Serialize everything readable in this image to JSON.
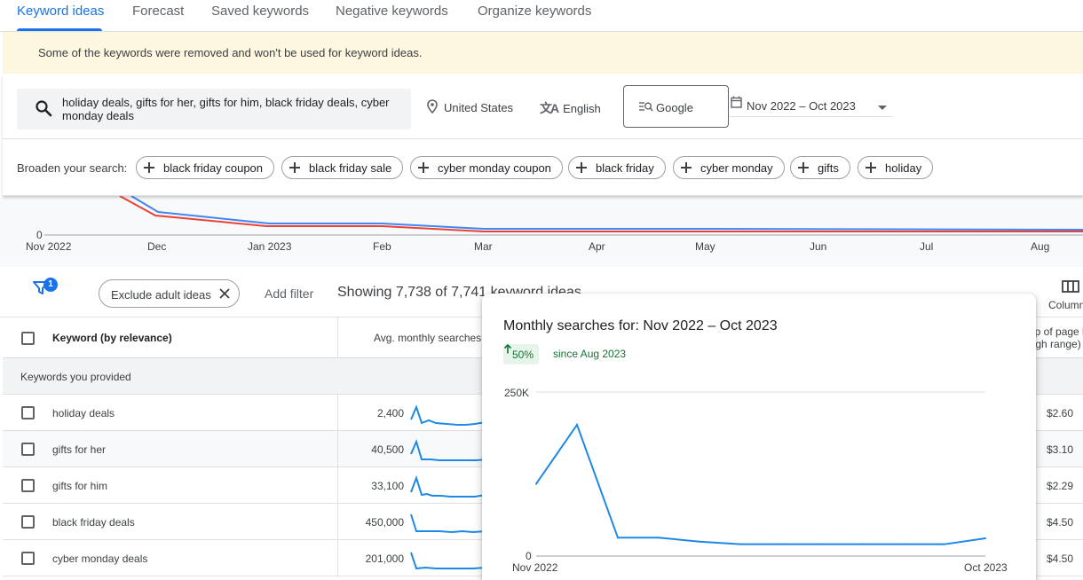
{
  "tabs": [
    {
      "label": "Keyword ideas"
    },
    {
      "label": "Forecast"
    },
    {
      "label": "Saved keywords"
    },
    {
      "label": "Negative keywords"
    },
    {
      "label": "Organize keywords"
    }
  ],
  "notice": "Some of the keywords were removed and won't be used for keyword ideas.",
  "search": {
    "query": "holiday deals, gifts for her, gifts for him, black friday deals, cyber monday deals",
    "location": "United States",
    "language": "English",
    "network": "Google",
    "date_range": "Nov 2022 – Oct 2023"
  },
  "broaden": {
    "label": "Broaden your search:",
    "chips": [
      "black friday coupon",
      "black friday sale",
      "cyber monday coupon",
      "black friday",
      "cyber monday",
      "gifts",
      "holiday"
    ]
  },
  "trend": {
    "zero_label": "0",
    "x_labels": [
      "Nov 2022",
      "Dec",
      "Jan 2023",
      "Feb",
      "Mar",
      "Apr",
      "May",
      "Jun",
      "Jul",
      "Aug"
    ],
    "colors": {
      "series_a": "#4285f4",
      "series_b": "#ea4335"
    }
  },
  "filter_bar": {
    "filter_count": "1",
    "exclude_chip": "Exclude adult ideas",
    "add_filter": "Add filter",
    "showing": "Showing 7,738 of 7,741 keyword ideas",
    "columns_label": "Columns"
  },
  "table": {
    "headers": {
      "keyword": "Keyword (by relevance)",
      "avg": "Avg. monthly searches",
      "bid_line1": "Top of page bid",
      "bid_line2": "(high range)"
    },
    "group_label": "Keywords you provided",
    "rows": [
      {
        "keyword": "holiday deals",
        "avg": "2,400",
        "bid": "$2.60"
      },
      {
        "keyword": "gifts for her",
        "avg": "40,500",
        "bid": "$3.10"
      },
      {
        "keyword": "gifts for him",
        "avg": "33,100",
        "bid": "$2.29"
      },
      {
        "keyword": "black friday deals",
        "avg": "450,000",
        "bid": "$4.50"
      },
      {
        "keyword": "cyber monday deals",
        "avg": "201,000",
        "bid": "$4.50"
      }
    ]
  },
  "popup": {
    "title": "Monthly searches for: Nov 2022 – Oct 2023",
    "delta": "50%",
    "since": "since Aug 2023",
    "y_top_label": "250K",
    "y_zero_label": "0",
    "x_start": "Nov 2022",
    "x_end": "Oct 2023",
    "line_color": "#1e88e5"
  },
  "chart_data": {
    "type": "line",
    "x": [
      "Nov 2022",
      "Dec 2022",
      "Jan 2023",
      "Feb 2023",
      "Mar 2023",
      "Apr 2023",
      "May 2023",
      "Jun 2023",
      "Jul 2023",
      "Aug 2023",
      "Sep 2023",
      "Oct 2023"
    ],
    "values": [
      110000,
      200000,
      28000,
      28000,
      22000,
      18000,
      18000,
      18000,
      18000,
      18000,
      18000,
      27000
    ],
    "ylim": [
      0,
      250000
    ],
    "y_ticks": [
      "0",
      "250K"
    ],
    "grid": true
  }
}
